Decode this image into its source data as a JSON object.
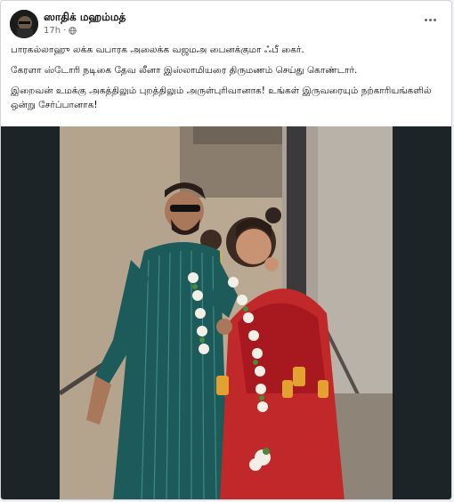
{
  "post": {
    "author": "ஸாதிக் மஹம்மத்",
    "time": "17h",
    "audience_icon": "globe-icon",
    "more_icon": "more-options-icon",
    "lines": [
      "பாரகல்லாஹு லக்க வபாரக அலைக்க வஜமஅ பைனக்குமா ஃபீ கைர்.",
      "கேரளா ஸ்டோரி நடிகை தேவ லீனா இஸ்லாமியரை திருமணம் செய்து கொண்டார்.",
      "இறைவன் உமக்கு அகத்திலும் புறத்திலும் அருள்புரிவானாக! உங்கள் இருவரையும் நற்காரியங்களில் ஒன்று சேர்ப்பானாக!"
    ]
  },
  "photo": {
    "description_icon": "wedding-photo"
  },
  "colors": {
    "text": "#050505",
    "muted": "#65676b",
    "photo_bg": "#1c2428"
  }
}
